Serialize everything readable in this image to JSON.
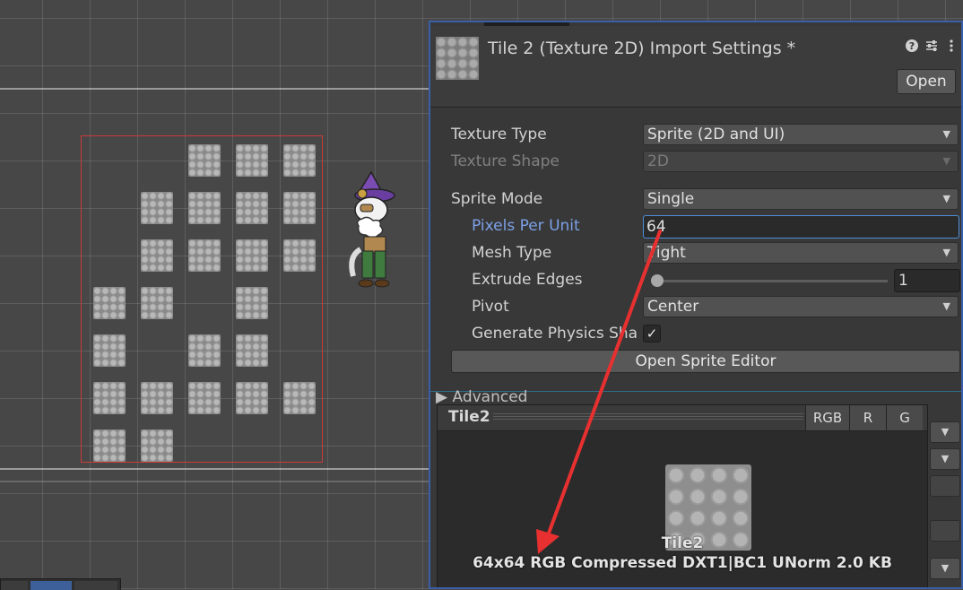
{
  "inspector": {
    "title": "Tile 2 (Texture 2D) Import Settings *",
    "open_button": "Open",
    "help_icon": "help-icon",
    "settings_icon": "preset-icon",
    "menu_icon": "kebab-menu-icon",
    "fields": {
      "texture_type": {
        "label": "Texture Type",
        "value": "Sprite (2D and UI)"
      },
      "texture_shape": {
        "label": "Texture Shape",
        "value": "2D"
      },
      "sprite_mode": {
        "label": "Sprite Mode",
        "value": "Single"
      },
      "pixels_per_unit": {
        "label": "Pixels Per Unit",
        "value": "64"
      },
      "mesh_type": {
        "label": "Mesh Type",
        "value": "Tight"
      },
      "extrude_edges": {
        "label": "Extrude Edges",
        "value": "1"
      },
      "pivot": {
        "label": "Pivot",
        "value": "Center"
      },
      "generate_physics_shape": {
        "label": "Generate Physics Sha",
        "checked": "✓"
      }
    },
    "open_sprite_editor": "Open Sprite Editor",
    "advanced_label": "Advanced"
  },
  "preview": {
    "title": "Tile2",
    "channels": [
      "RGB",
      "R",
      "G"
    ],
    "asset_name": "Tile2",
    "info": "64x64  RGB Compressed DXT1|BC1 UNorm   2.0 KB"
  },
  "colors": {
    "annotation_arrow": "#e83030",
    "selection_rect": "#c83a3a",
    "focus_border": "#4f8ed8",
    "accent_blue": "#7ca0e6"
  }
}
